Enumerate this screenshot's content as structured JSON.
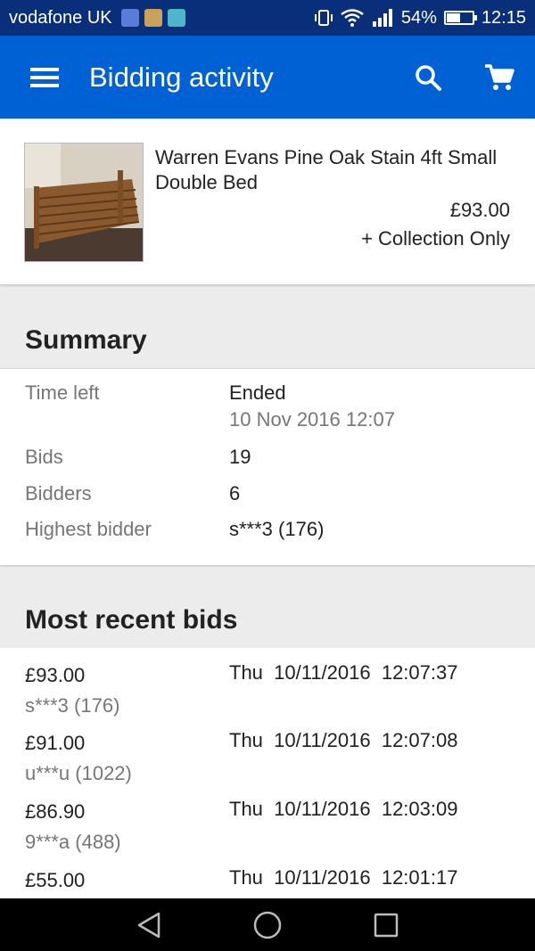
{
  "status_bar": {
    "carrier": "vodafone UK",
    "battery_percent": "54%",
    "battery_level": 0.54,
    "time": "12:15"
  },
  "app_bar": {
    "title": "Bidding activity",
    "icons": [
      "menu-icon",
      "search-icon",
      "cart-icon"
    ]
  },
  "item": {
    "title": "Warren Evans Pine Oak Stain  4ft Small Double Bed",
    "price": "£93.00",
    "shipping": "+ Collection Only"
  },
  "summary": {
    "heading": "Summary",
    "time_left_label": "Time left",
    "time_left_value": "Ended",
    "end_date": "10 Nov 2016 12:07",
    "bids_label": "Bids",
    "bids_value": "19",
    "bidders_label": "Bidders",
    "bidders_value": "6",
    "highest_bidder_label": "Highest bidder",
    "highest_bidder_value": "s***3 (176)"
  },
  "recent_bids": {
    "heading": "Most recent bids",
    "items": [
      {
        "amount": "£93.00",
        "bidder": "s***3 (176)",
        "when": "Thu  10/11/2016  12:07:37"
      },
      {
        "amount": "£91.00",
        "bidder": "u***u (1022)",
        "when": "Thu  10/11/2016  12:07:08"
      },
      {
        "amount": "£86.90",
        "bidder": "9***a (488)",
        "when": "Thu  10/11/2016  12:03:09"
      },
      {
        "amount": "£55.00",
        "bidder": "",
        "when": "Thu  10/11/2016  12:01:17"
      }
    ]
  },
  "nav_bar": {
    "icons": [
      "back-icon",
      "home-icon",
      "recents-icon"
    ]
  },
  "colors": {
    "status_bar": "#0a2f7a",
    "app_bar": "#0061d5",
    "background": "#ececec"
  }
}
